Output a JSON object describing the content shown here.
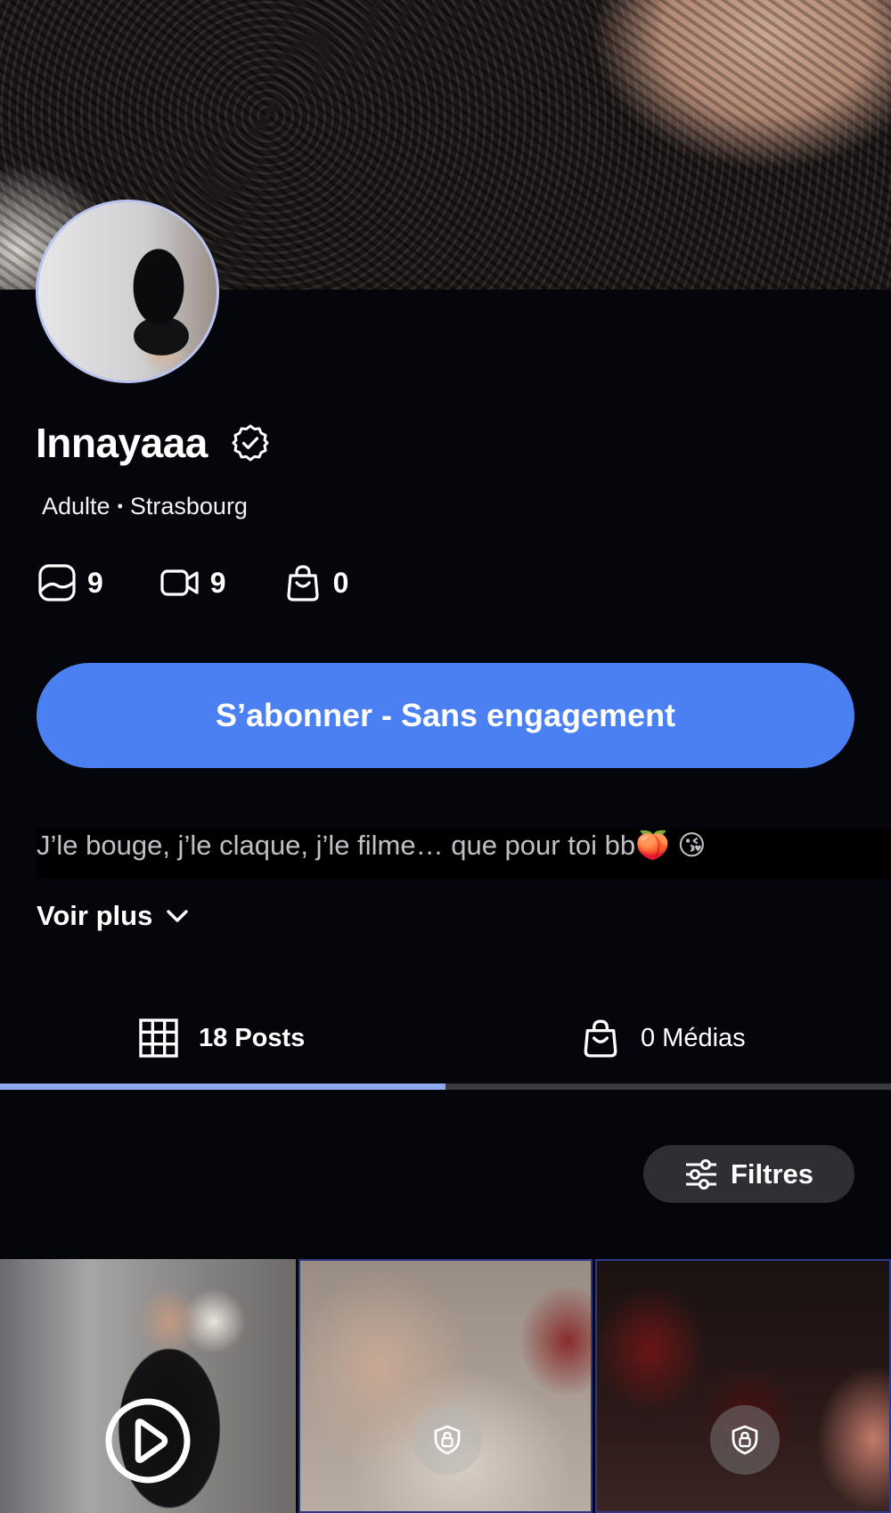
{
  "profile": {
    "name": "Innayaaa",
    "category": "Adulte",
    "location": "Strasbourg",
    "separator": "•",
    "verified_icon": "verified-badge-icon"
  },
  "stats": {
    "photos": "9",
    "videos": "9",
    "shop": "0",
    "photos_icon": "photo-icon",
    "videos_icon": "video-camera-icon",
    "shop_icon": "shopping-bag-icon"
  },
  "subscribe": {
    "label": "S’abonner - Sans engagement",
    "color": "#4b80f3"
  },
  "bio": {
    "text": "J’le bouge, j’le claque, j’le filme… que pour toi bb🍑 😘",
    "more_label": "Voir plus"
  },
  "tabs": [
    {
      "label": "18 Posts",
      "icon": "grid-icon",
      "active": true
    },
    {
      "label": "0 Médias",
      "icon": "shopping-bag-icon",
      "active": false
    }
  ],
  "filters": {
    "label": "Filtres",
    "icon": "sliders-icon"
  },
  "posts": [
    {
      "type": "video",
      "locked": false,
      "icon": "play-icon"
    },
    {
      "type": "photo",
      "locked": true,
      "icon": "lock-shield-icon"
    },
    {
      "type": "photo",
      "locked": true,
      "icon": "lock-shield-icon"
    }
  ],
  "colors": {
    "background": "#05060b",
    "accent": "#4b80f3",
    "tab_indicator": "#8ea9ef"
  }
}
